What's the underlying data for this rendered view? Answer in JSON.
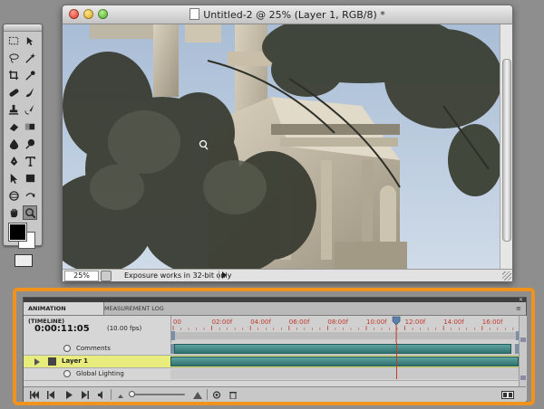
{
  "document": {
    "title": "Untitled-2 @ 25% (Layer 1, RGB/8) *",
    "zoom": "25%",
    "status_text": "Exposure works in 32-bit only"
  },
  "animation_panel": {
    "tabs": [
      {
        "label": "ANIMATION (TIMELINE)",
        "active": true
      },
      {
        "label": "MEASUREMENT LOG",
        "active": false
      }
    ],
    "current_time": "0:00:11:05",
    "fps": "(10.00 fps)",
    "ruler_labels": [
      "00",
      "02:00f",
      "04:00f",
      "06:00f",
      "08:00f",
      "10:00f",
      "12:00f",
      "14:00f",
      "16:00f"
    ],
    "playhead_label": "12",
    "playhead_fraction": 0.646,
    "layers": [
      {
        "name": "Comments",
        "selected": false
      },
      {
        "name": "Layer 1",
        "selected": true
      },
      {
        "name": "Global Lighting",
        "selected": false
      }
    ]
  },
  "colors": {
    "highlight": "#f0921b",
    "ruler_text": "#c0392b",
    "playhead": "#c0392b",
    "layer_bar": "#3f8784",
    "selected_row": "#e8ec7c"
  },
  "icons": {
    "tools": [
      "marquee-icon",
      "move-icon",
      "lasso-icon",
      "magic-wand-icon",
      "crop-icon",
      "eyedropper-icon",
      "healing-icon",
      "brush-icon",
      "stamp-icon",
      "history-brush-icon",
      "eraser-icon",
      "gradient-icon",
      "blur-icon",
      "dodge-icon",
      "pen-icon",
      "type-icon",
      "path-select-icon",
      "shape-icon",
      "3d-rotate-icon",
      "3d-orbit-icon",
      "hand-icon",
      "zoom-icon"
    ]
  }
}
